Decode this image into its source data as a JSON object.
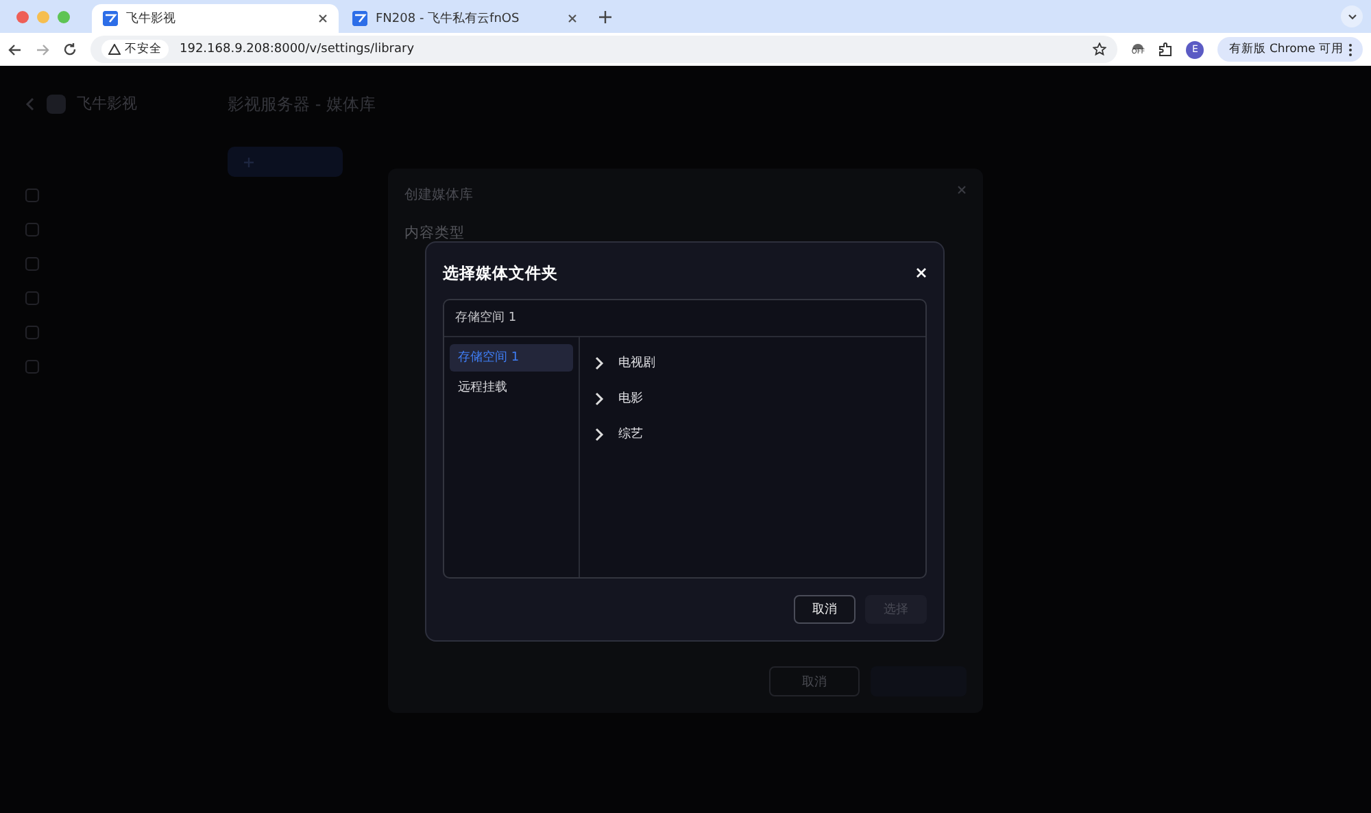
{
  "browser": {
    "tabs": [
      {
        "title": "飞牛影视",
        "selected": true
      },
      {
        "title": "FN208 - 飞牛私有云fnOS",
        "selected": false
      }
    ],
    "url_warning": "不安全",
    "url": "192.168.9.208:8000/v/settings/library",
    "extension_badge": "OFF",
    "profile_initial": "E",
    "update_button": "有新版 Chrome 可用"
  },
  "app": {
    "name": "飞牛影视",
    "page_title": "影视服务器 - 媒体库"
  },
  "create_dialog": {
    "title": "创建媒体库",
    "section": "内容类型",
    "cancel": "取消"
  },
  "folder_dialog": {
    "title": "选择媒体文件夹",
    "path": "存储空间 1",
    "sources": [
      {
        "label": "存储空间 1",
        "selected": true
      },
      {
        "label": "远程挂载",
        "selected": false
      }
    ],
    "folders": [
      "电视剧",
      "电影",
      "综艺"
    ],
    "buttons": [
      {
        "label": "取消",
        "disabled": false
      },
      {
        "label": "选择",
        "disabled": true
      }
    ]
  }
}
